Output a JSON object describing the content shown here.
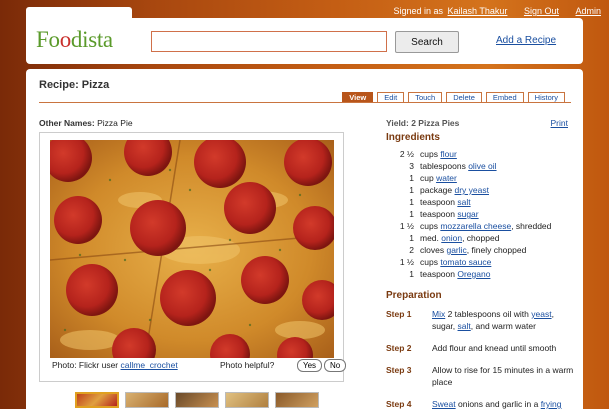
{
  "userbar": {
    "signed_in_prefix": "Signed in as",
    "user": "Kailash Thakur",
    "signout": "Sign Out",
    "admin": "Admin"
  },
  "header": {
    "logo": {
      "a": "Fo",
      "b": "o",
      "c": "dista"
    },
    "search": {
      "value": "",
      "placeholder": ""
    },
    "search_button": "Search",
    "add_recipe": "Add a Recipe"
  },
  "recipe": {
    "title": "Recipe: Pizza",
    "tabs": [
      "View",
      "Edit",
      "Touch",
      "Delete",
      "Embed",
      "History"
    ],
    "other_names_label": "Other Names:",
    "other_names": "Pizza Pie",
    "yield": "Yield: 2 Pizza Pies",
    "print": "Print",
    "photo_credit_prefix": "Photo: Flickr user",
    "photo_credit_user": "callme_crochet",
    "photo_helpful": "Photo helpful?",
    "yes": "Yes",
    "no": "No",
    "ingredients_heading": "Ingredients",
    "ingredients": [
      {
        "qty": "2 ½",
        "pre": "cups ",
        "link": "flour",
        "post": ""
      },
      {
        "qty": "3",
        "pre": "tablespoons ",
        "link": "olive oil",
        "post": ""
      },
      {
        "qty": "1",
        "pre": "cup ",
        "link": "water",
        "post": ""
      },
      {
        "qty": "1",
        "pre": "package ",
        "link": "dry yeast",
        "post": ""
      },
      {
        "qty": "1",
        "pre": "teaspoon ",
        "link": "salt",
        "post": ""
      },
      {
        "qty": "1",
        "pre": "teaspoon ",
        "link": "sugar",
        "post": ""
      },
      {
        "qty": "1 ½",
        "pre": "cups ",
        "link": "mozzarella cheese",
        "post": ", shredded"
      },
      {
        "qty": "1",
        "pre": "med. ",
        "link": "onion",
        "post": ", chopped"
      },
      {
        "qty": "2",
        "pre": "cloves ",
        "link": "garlic",
        "post": ", finely chopped"
      },
      {
        "qty": "1 ½",
        "pre": "cups ",
        "link": "tomato sauce",
        "post": ""
      },
      {
        "qty": "1",
        "pre": "teaspoon ",
        "link": "Oregano",
        "post": ""
      }
    ],
    "preparation_heading": "Preparation",
    "steps": [
      {
        "label": "Step 1",
        "parts": [
          {
            "t": "Mix",
            "l": true
          },
          {
            "t": " 2 tablespoons oil with ",
            "l": false
          },
          {
            "t": "yeast",
            "l": true
          },
          {
            "t": ", sugar, ",
            "l": false
          },
          {
            "t": "salt",
            "l": true
          },
          {
            "t": ", and warm water",
            "l": false
          }
        ]
      },
      {
        "label": "Step 2",
        "parts": [
          {
            "t": "Add flour and knead until smooth",
            "l": false
          }
        ]
      },
      {
        "label": "Step 3",
        "parts": [
          {
            "t": "Allow to rise for 15 minutes in a warm place",
            "l": false
          }
        ]
      },
      {
        "label": "Step 4",
        "parts": [
          {
            "t": "Sweat",
            "l": true
          },
          {
            "t": " onions and garlic in a ",
            "l": false
          },
          {
            "t": "frying",
            "l": true
          }
        ]
      }
    ]
  },
  "colors": {
    "accent": "#b8551a",
    "link": "#1a4fa0",
    "logo_green": "#5a9a2a",
    "logo_red": "#c9302c"
  }
}
